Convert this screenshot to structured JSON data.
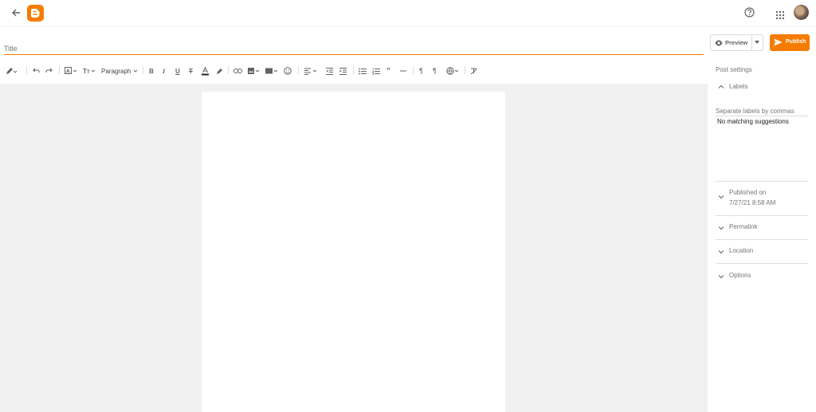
{
  "header": {
    "back_icon": "arrow-left-icon",
    "logo_icon": "blogger-logo-icon",
    "help_icon": "help-circle-icon",
    "apps_icon": "apps-grid-icon",
    "avatar_icon": "user-avatar"
  },
  "editor": {
    "title_placeholder": "Title",
    "toolbar": {
      "paragraph_label": "Paragraph"
    }
  },
  "actions": {
    "preview_label": "Preview",
    "publish_label": "Publish"
  },
  "sidebar": {
    "title": "Post settings",
    "labels": {
      "heading": "Labels",
      "input_placeholder": "Separate labels by commas",
      "suggestion": "No matching suggestions"
    },
    "published": {
      "heading": "Published on",
      "date": "7/27/21 8:58 AM"
    },
    "permalink": "Permalink",
    "location": "Location",
    "options": "Options"
  },
  "colors": {
    "accent": "#f57c00",
    "canvas": "#f1f1f1"
  }
}
